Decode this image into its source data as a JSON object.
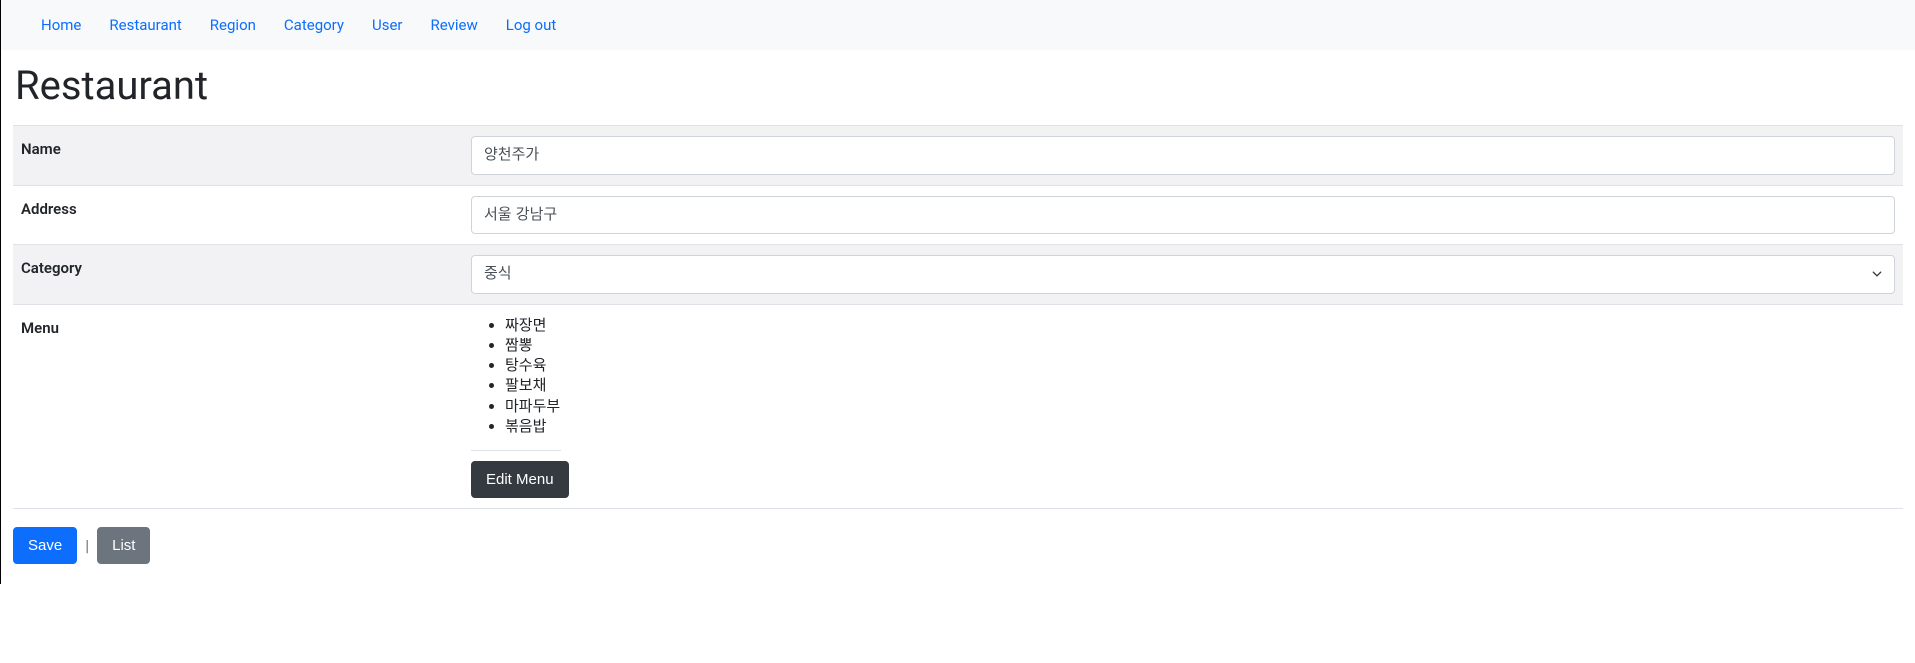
{
  "nav": {
    "items": [
      {
        "label": "Home"
      },
      {
        "label": "Restaurant"
      },
      {
        "label": "Region"
      },
      {
        "label": "Category"
      },
      {
        "label": "User"
      },
      {
        "label": "Review"
      },
      {
        "label": "Log out"
      }
    ]
  },
  "page": {
    "title": "Restaurant"
  },
  "form": {
    "name_label": "Name",
    "name_value": "양천주가",
    "address_label": "Address",
    "address_value": "서울 강남구",
    "category_label": "Category",
    "category_selected": "중식",
    "menu_label": "Menu",
    "menu_items": [
      "짜장면",
      "짬뽕",
      "탕수육",
      "팔보채",
      "마파두부",
      "볶음밥"
    ],
    "edit_menu_label": "Edit Menu"
  },
  "actions": {
    "save_label": "Save",
    "list_label": "List",
    "divider": "|"
  }
}
